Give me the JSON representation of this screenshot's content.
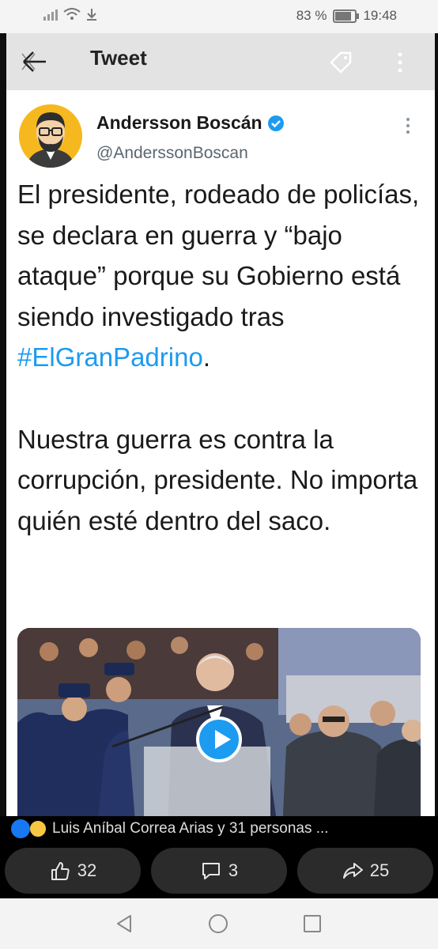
{
  "status_bar": {
    "battery_text": "83 %",
    "time": "19:48",
    "battery_level": 0.83
  },
  "tweet_header": {
    "title": "Tweet"
  },
  "tweet": {
    "author_name": "Andersson Boscán",
    "author_handle": "@AnderssonBoscan",
    "paragraph1_text": "El presidente, rodeado de policías, se declara en guerra y “bajo ataque” porque su Gobierno está siendo investigado tras ",
    "hashtag": "#ElGranPadrino",
    "paragraph1_end": ".",
    "paragraph2_text": "Nuestra guerra es contra la corrupción, presidente. No importa quién esté dentro del saco.",
    "hashtag_color": "#1d9bf0"
  },
  "facebook_post": {
    "reactions_text": "Luis Aníbal Correa Arias y 31 personas ...",
    "like_count": "32",
    "comment_count": "3",
    "share_count": "25"
  },
  "icons": {
    "back": "back-arrow-icon",
    "tag": "tag-icon",
    "more": "more-vertical-icon",
    "verified": "verified-badge-icon",
    "play": "play-icon",
    "like": "thumbs-up-icon",
    "comment": "comment-icon",
    "share": "share-icon"
  }
}
